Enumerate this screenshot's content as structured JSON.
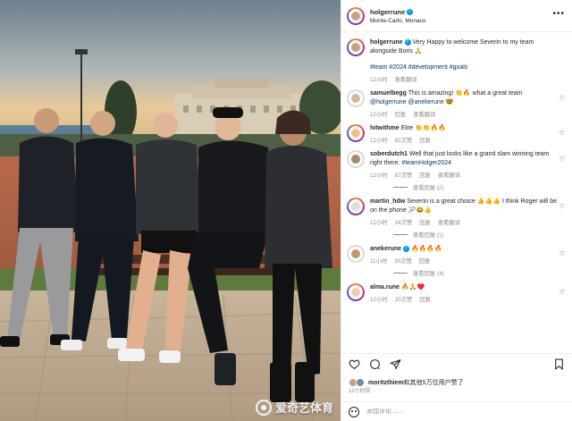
{
  "post": {
    "username": "holgerrune",
    "location": "Monte-Carlo, Monaco",
    "caption": "Very Happy to welcome Severin to my team alongside Boris 🙏",
    "hashtags": "#team #2024 #development #goals",
    "time": "12小时",
    "translate": "查看翻译"
  },
  "comments": [
    {
      "username": "samuelbegg",
      "text": "This is amazing! 👏🔥 what a great team",
      "text2": "@holgerrune @anekerune 🤓",
      "time": "12小时",
      "likes": "",
      "reply": "回复",
      "translate": "查看翻译"
    },
    {
      "username": "hitwithme",
      "text": "Elite 👏👏🔥🔥",
      "time": "12小时",
      "likes": "82次赞",
      "reply": "回复",
      "translate": ""
    },
    {
      "username": "soberdutch1",
      "text": "Well that just looks like a grand slam winning team right there.",
      "tag": "#teamHolger2024",
      "time": "12小时",
      "likes": "87次赞",
      "reply": "回复",
      "translate": "查看翻译",
      "view_replies": "查看回复 (2)"
    },
    {
      "username": "martin_hdw",
      "text": "Severin is a great choice 👍👍👍 I think Roger will be on the phone 🎾😂👍",
      "time": "12小时",
      "likes": "34次赞",
      "reply": "回复",
      "translate": "查看翻译",
      "view_replies": "查看回复 (1)"
    },
    {
      "username": "anekerune",
      "text": "🔥🔥🔥🔥",
      "time": "11小时",
      "likes": "30次赞",
      "reply": "回复",
      "translate": "",
      "view_replies": "查看回复 (4)"
    },
    {
      "username": "alma.rune",
      "text": "🔥🙏♥️",
      "time": "12小时",
      "likes": "20次赞",
      "reply": "回复",
      "translate": ""
    }
  ],
  "likes_line": {
    "user": "moritzthiem",
    "rest": "和其他5万位用户赞了"
  },
  "post_time": "12小时前",
  "add_comment_placeholder": "添加评论……",
  "watermark": "爱奇艺体育",
  "icons": {
    "more": "more-dots-icon",
    "heart": "heart-icon",
    "comment": "comment-icon",
    "share": "share-icon",
    "bookmark": "bookmark-icon"
  }
}
